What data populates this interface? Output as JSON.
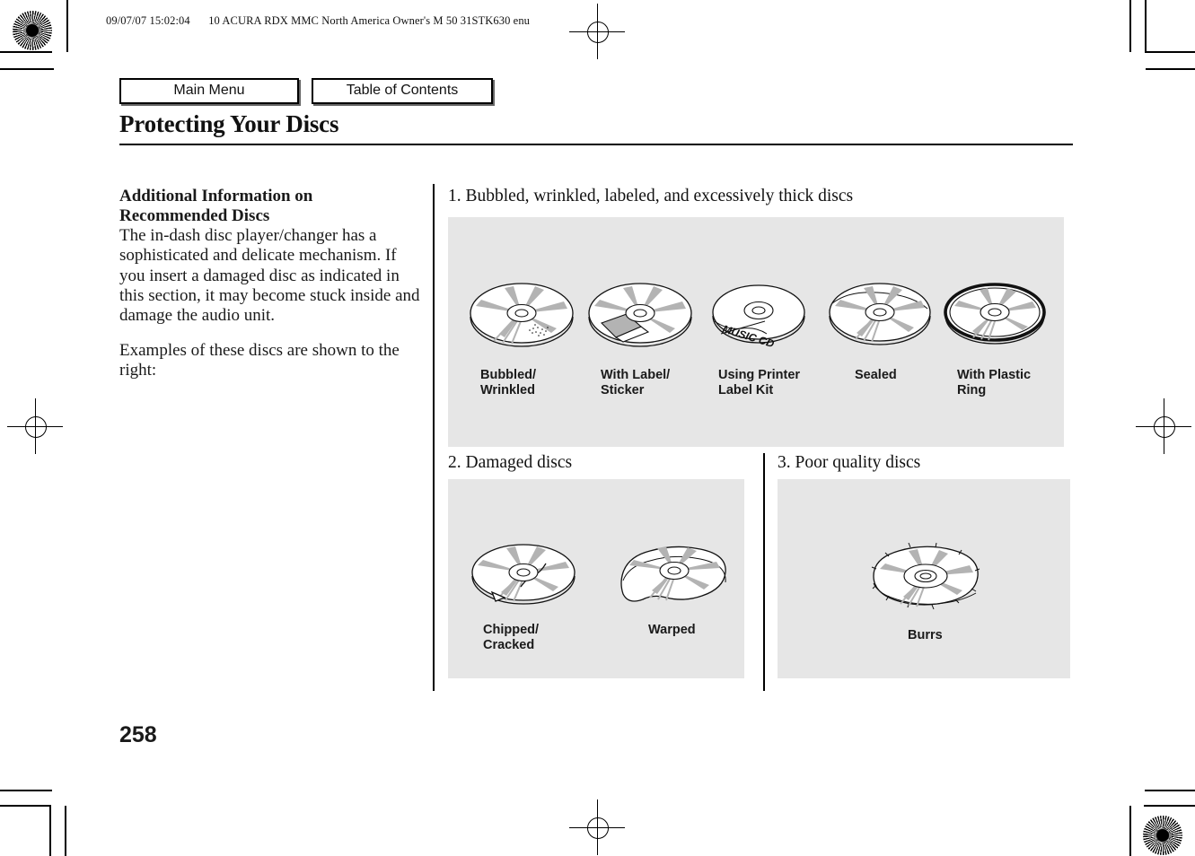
{
  "print_header": {
    "timestamp": "09/07/07 15:02:04",
    "doc_info": "10 ACURA RDX MMC North America Owner's M 50 31STK630 enu"
  },
  "nav": {
    "main_menu_label": "Main Menu",
    "table_of_contents_label": "Table of Contents"
  },
  "page": {
    "title": "Protecting Your Discs",
    "number": "258"
  },
  "left_column": {
    "heading": "Additional Information on Recommended Discs",
    "paragraph_1": "The in-dash disc player/changer has a sophisticated and delicate mechanism. If you insert a damaged disc as indicated in this section, it may become stuck inside and damage the audio unit.",
    "paragraph_2": "Examples of these discs are shown to the right:"
  },
  "sections": [
    {
      "heading": "1. Bubbled, wrinkled, labeled, and excessively thick discs",
      "discs": [
        {
          "label": "Bubbled/\nWrinkled",
          "type": "bubbled"
        },
        {
          "label": "With Label/\nSticker",
          "type": "sticker"
        },
        {
          "label": "Using Printer\nLabel Kit",
          "type": "printer-kit",
          "disc_text": "MUSIC CD"
        },
        {
          "label": "Sealed",
          "type": "sealed"
        },
        {
          "label": "With Plastic\nRing",
          "type": "plastic-ring"
        }
      ]
    },
    {
      "heading": "2. Damaged discs",
      "discs": [
        {
          "label": "Chipped/\nCracked",
          "type": "chipped"
        },
        {
          "label": "Warped",
          "type": "warped"
        }
      ]
    },
    {
      "heading": "3. Poor quality discs",
      "discs": [
        {
          "label": "Burrs",
          "type": "burrs"
        }
      ]
    }
  ],
  "colors": {
    "panel_background": "#e6e6e6",
    "text": "#1a1a1a",
    "rule": "#000000",
    "disc_sheen": "#b3b3b3"
  }
}
